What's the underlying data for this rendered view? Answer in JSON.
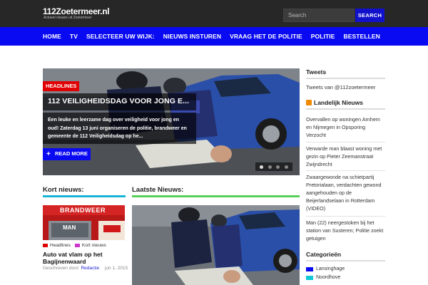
{
  "header": {
    "logo_title": "112Zoetermeer.nl",
    "logo_subtitle": "Actueel nieuws uit Zoetermeer",
    "search_placeholder": "Search",
    "search_button": "SEARCH"
  },
  "nav": {
    "items": [
      "HOME",
      "TV",
      "SELECTEER UW WIJK:",
      "NIEUWS INSTUREN",
      "VRAAG HET DE POLITIE",
      "POLITIE",
      "BESTELLEN"
    ]
  },
  "slider": {
    "tag": "HEADLINES",
    "title": "112 VEILIGHEIDSDAG VOOR JONG E...",
    "excerpt": "Een leuke en leerzame dag over veiligheid voor jong en oud! Zaterdag 13 juni organiseren de politie, brandweer en gemeente de 112 Veiligheidsdag op he...",
    "read_more": "READ MORE",
    "dots": 4,
    "active_dot": 0
  },
  "kort_nieuws": {
    "heading": "Kort nieuws:",
    "image_text_top": "BRANDWEER",
    "image_text_mid": "MAN",
    "categories": [
      {
        "label": "Headlines",
        "color": "#e00000"
      },
      {
        "label": "Kort nieuws",
        "color": "#cc33cc"
      }
    ],
    "title": "Auto vat vlam op het Bagijnenwaard",
    "meta_prefix": "Geschreven door:",
    "author": "Redactie",
    "date": "jun 1, 2015"
  },
  "laatste_nieuws": {
    "heading": "Laatste Nieuws:"
  },
  "sidebar": {
    "tweets_heading": "Tweets",
    "tweets_text": "Tweets van @112zoetermeer",
    "landelijk_heading": "Landelijk Nieuws",
    "news": [
      "Overvallen op woningen Arnhem en Nijmegen in Opsporing Verzocht",
      "Verwarde man blaast woning met gezin op Pieter Zeemanstraat Zwijndrecht",
      "Zwaargewonde na schietpartij Pretorialaan, verdachten gewond aangehouden op de Beijerlandselaan in Rotterdam (VIDEO)",
      "Man (22) neergestoken bij het station van Susteren; Politie zoekt getuigen"
    ],
    "categories_heading": "Categorieën",
    "categories": [
      {
        "label": "Lansinghage",
        "color": "#0a0af2"
      },
      {
        "label": "Noordhove",
        "color": "#12c8d8"
      }
    ]
  },
  "colors": {
    "brand_blue": "#0a0af2",
    "topbar": "#272727",
    "headlines_red": "#e00000",
    "kort_line": "#18b4d8",
    "laatste_line": "#58d058"
  }
}
